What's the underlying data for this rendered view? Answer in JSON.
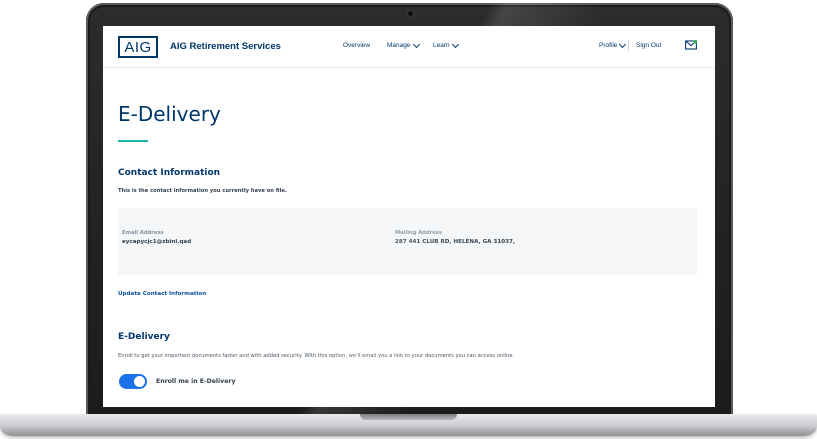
{
  "header": {
    "logo": "AIG",
    "brand": "AIG Retirement Services",
    "nav": [
      {
        "label": "Overview"
      },
      {
        "label": "Manage"
      },
      {
        "label": "Learn"
      }
    ],
    "profile": "Profile",
    "sign_out": "Sign Out"
  },
  "page": {
    "title": "E-Delivery",
    "accent_color": "#1bb5b0"
  },
  "contact": {
    "heading": "Contact Information",
    "subtitle": "This is the contact information you currently have on file.",
    "email_label": "Email Address",
    "email_value": "eycapycjc1@zbinl.qad",
    "mail_label": "Mailing Address",
    "mail_value": "287 441 CLUB RD, HELENA, GA 31037,",
    "update_link": "Update Contact Information"
  },
  "edelivery": {
    "heading": "E-Delivery",
    "description": "Enroll to get your important documents faster and with added security. With this option, we'll email you a link to your documents you can access online.",
    "toggle_label": "Enroll me in E-Delivery",
    "toggle_on": true
  }
}
